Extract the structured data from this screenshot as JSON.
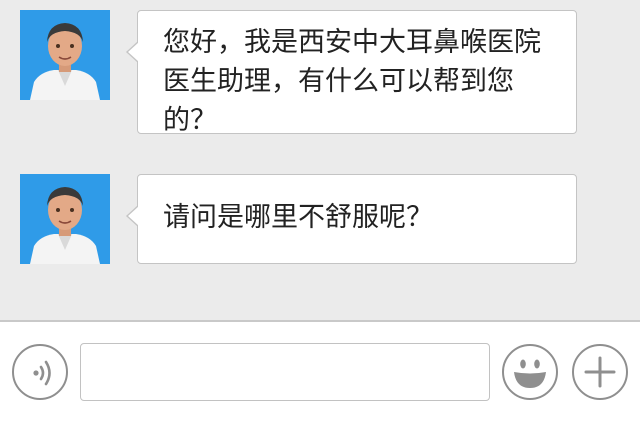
{
  "messages": [
    {
      "sender": "doctor-assistant",
      "avatar_icon": "doctor-avatar-icon",
      "text": "您好，我是西安中大耳鼻喉医院医生助理，有什么可以帮到您的？"
    },
    {
      "sender": "doctor-assistant",
      "avatar_icon": "doctor-avatar-icon",
      "text": "请问是哪里不舒服呢？"
    }
  ],
  "input_bar": {
    "voice_button_icon": "voice-wave-icon",
    "message_input_value": "",
    "emoji_button_icon": "smiley-face-icon",
    "more_button_icon": "plus-icon"
  },
  "colors": {
    "chat_background": "#ebebeb",
    "bubble_background": "#ffffff",
    "avatar_background": "#2f9be8",
    "icon_gray": "#8f8f8f"
  }
}
